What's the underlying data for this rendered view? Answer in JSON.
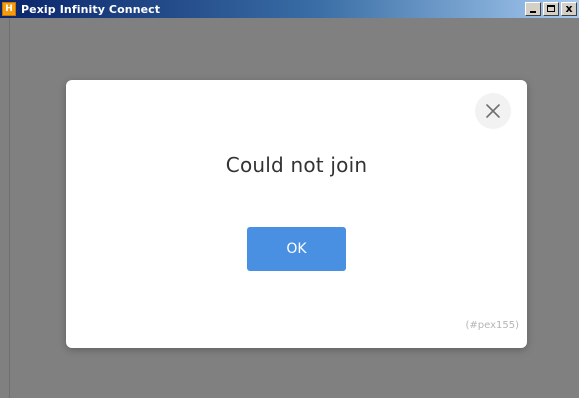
{
  "window": {
    "title": "Pexip Infinity Connect",
    "app_icon_glyph": "H",
    "controls": {
      "minimize": "minimize",
      "maximize": "maximize",
      "close": "x"
    },
    "background_color": "#808080"
  },
  "dialog": {
    "title": "Could not join",
    "ok_label": "OK",
    "error_code": "(#pex155)",
    "close_icon": "close-icon",
    "accent_color": "#4a90e2"
  }
}
